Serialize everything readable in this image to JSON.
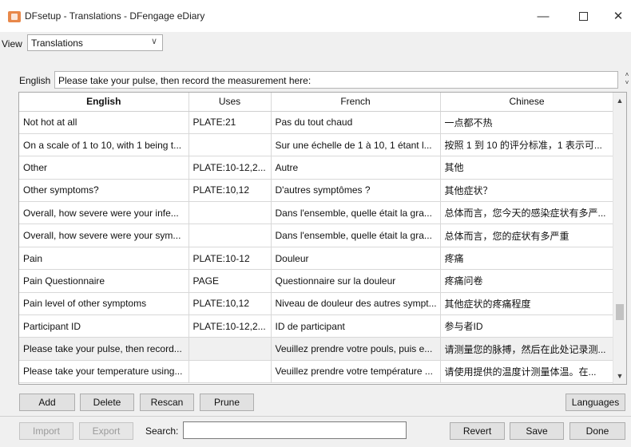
{
  "window": {
    "title": "DFsetup - Translations - DFengage eDiary",
    "minimize_glyph": "—",
    "close_glyph": "✕"
  },
  "view": {
    "label": "View",
    "selected": "Translations"
  },
  "editor": {
    "label": "English",
    "value": "Please take your pulse, then record the measurement here:"
  },
  "table": {
    "columns": [
      "English",
      "Uses",
      "French",
      "Chinese"
    ],
    "rows": [
      [
        "Not hot at all",
        "PLATE:21",
        "Pas du tout chaud",
        "一点都不热"
      ],
      [
        "On a scale of 1 to 10, with 1 being t...",
        "",
        "Sur une échelle de 1 à 10, 1 étant l...",
        "按照 1 到 10 的评分标准，1 表示可..."
      ],
      [
        "Other",
        "PLATE:10-12,2...",
        "Autre",
        "其他"
      ],
      [
        "Other symptoms?",
        "PLATE:10,12",
        "D'autres symptômes ?",
        "其他症状？"
      ],
      [
        "Overall, how severe were your infe...",
        "",
        "Dans l'ensemble, quelle était la gra...",
        "总体而言，您今天的感染症状有多严..."
      ],
      [
        "Overall, how severe were your sym...",
        "",
        "Dans l'ensemble, quelle était la gra...",
        "总体而言，您的症状有多严重"
      ],
      [
        "Pain",
        "PLATE:10-12",
        "Douleur",
        "疼痛"
      ],
      [
        "Pain Questionnaire",
        "PAGE",
        "Questionnaire sur la douleur",
        "疼痛问卷"
      ],
      [
        "Pain level of other symptoms",
        "PLATE:10,12",
        "Niveau de douleur des autres sympt...",
        "其他症状的疼痛程度"
      ],
      [
        "Participant ID",
        "PLATE:10-12,2...",
        "ID de participant",
        "参与者ID"
      ],
      [
        "Please take your pulse, then record...",
        "",
        "Veuillez prendre votre pouls, puis e...",
        "请测量您的脉搏，然后在此处记录测..."
      ],
      [
        "Please take your temperature using...",
        "",
        "Veuillez prendre votre température ...",
        "请使用提供的温度计测量体温。在..."
      ]
    ],
    "selected_row": 10
  },
  "buttons": {
    "add": "Add",
    "delete": "Delete",
    "rescan": "Rescan",
    "prune": "Prune",
    "languages": "Languages",
    "import": "Import",
    "export": "Export",
    "revert": "Revert",
    "save": "Save",
    "done": "Done"
  },
  "search": {
    "label": "Search:",
    "value": ""
  }
}
